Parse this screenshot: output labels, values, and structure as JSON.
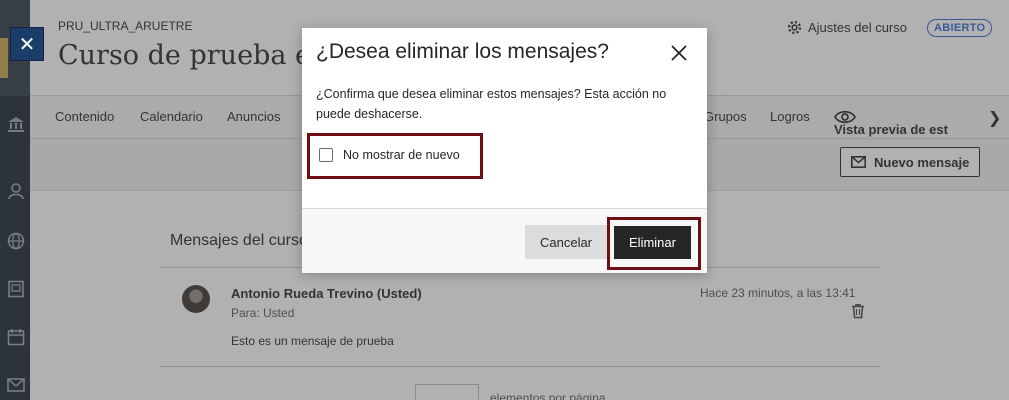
{
  "course": {
    "code": "PRU_ULTRA_ARUETRE",
    "title": "Curso de prueba en",
    "settings_label": "Ajustes del curso",
    "status_badge": "ABIERTO"
  },
  "nav": {
    "items": [
      "Contenido",
      "Calendario",
      "Anuncios",
      "Grupos",
      "Logros"
    ],
    "preview_label": "Vista previa de est"
  },
  "toolbar": {
    "new_message_label": "Nuevo mensaje"
  },
  "messages": {
    "section_title": "Mensajes del curso",
    "items": [
      {
        "sender": "Antonio Rueda Trevino (Usted)",
        "recipient": "Para: Usted",
        "timestamp": "Hace 23 minutos, a las 13:41",
        "body": "Esto es un mensaje de prueba"
      }
    ],
    "pager_text": "elementos por página"
  },
  "dialog": {
    "title": "¿Desea eliminar los mensajes?",
    "description": "¿Confirma que desea eliminar estos mensajes? Esta acción no puede deshacerse.",
    "checkbox_label": "No mostrar de nuevo",
    "cancel_label": "Cancelar",
    "delete_label": "Eliminar"
  },
  "icons": {
    "close": "close-icon",
    "gear": "gear-icon",
    "envelope": "envelope-icon",
    "eye": "eye-icon",
    "trash": "trash-icon",
    "chevron": "chevron-right-icon"
  },
  "colors": {
    "accent_blue": "#2d6bd4",
    "rail": "#1c2733",
    "highlight": "#6f0e12",
    "primary_button": "#262626"
  }
}
